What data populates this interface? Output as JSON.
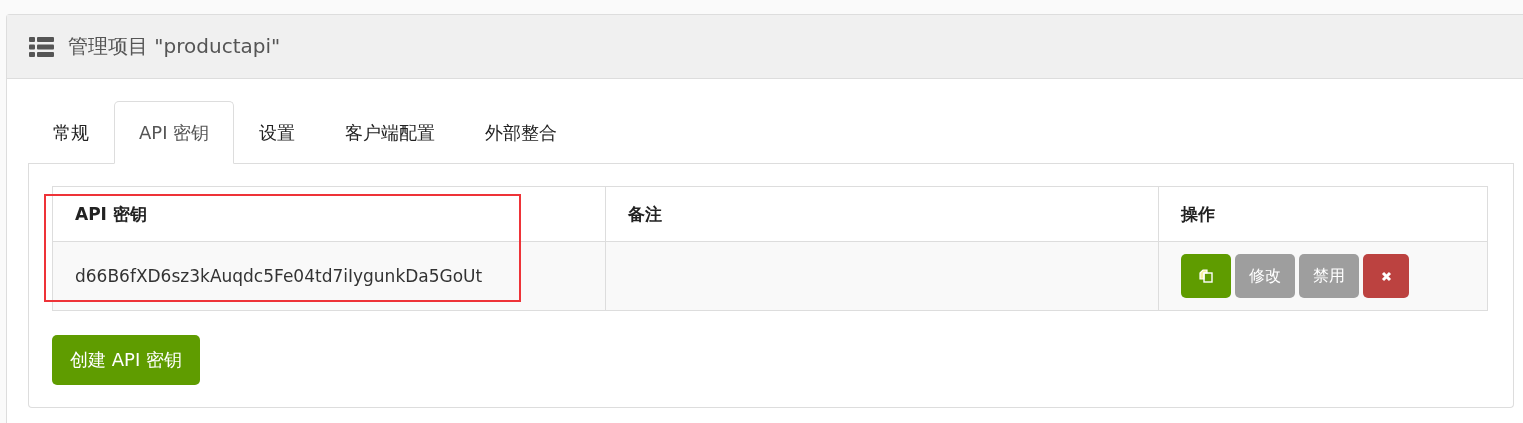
{
  "panel": {
    "title": "管理项目 \"productapi\""
  },
  "tabs": [
    {
      "label": "常规",
      "selected": false
    },
    {
      "label": "API 密钥",
      "selected": true
    },
    {
      "label": "设置",
      "selected": false
    },
    {
      "label": "客户端配置",
      "selected": false
    },
    {
      "label": "外部整合",
      "selected": false
    }
  ],
  "table": {
    "columns": [
      {
        "label": "API 密钥",
        "highlighted": true
      },
      {
        "label": "备注",
        "highlighted": false
      },
      {
        "label": "操作",
        "highlighted": false
      }
    ],
    "rows": [
      {
        "key": "d66B6fXD6sz3kAuqdc5Fe04td7iIygunkDa5GoUt",
        "note": "",
        "actions": [
          {
            "kind": "copy"
          },
          {
            "kind": "text",
            "label": "修改"
          },
          {
            "kind": "text",
            "label": "禁用"
          },
          {
            "kind": "delete"
          }
        ]
      }
    ]
  },
  "create_button": "创建 API 密钥"
}
